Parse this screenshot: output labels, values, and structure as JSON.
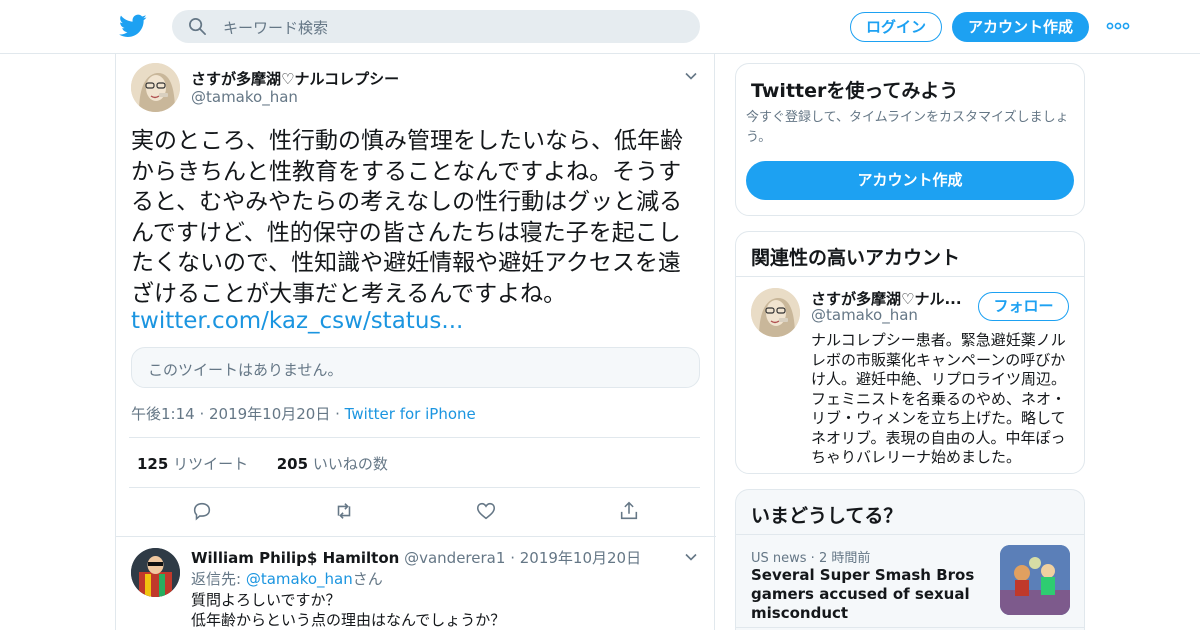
{
  "header": {
    "search_placeholder": "キーワード検索",
    "login_label": "ログイン",
    "signup_label": "アカウント作成"
  },
  "tweet": {
    "author_name": "さすが多摩湖♡ナルコレプシー",
    "author_handle": "@tamako_han",
    "text": "実のところ、性行動の慎み管理をしたいなら、低年齢からきちんと性教育をすることなんですよね。そうすると、むやみやたらの考えなしの性行動はグッと減るんですけど、性的保守の皆さんたちは寝た子を起こしたくないので、性知識や避妊情報や避妊アクセスを遠ざけることが大事だと考えるんですよね。",
    "link": "twitter.com/kaz_csw/status...",
    "quote_unavailable": "このツイートはありません。",
    "time": "午後1:14",
    "date": "2019年10月20日",
    "source": "Twitter for iPhone",
    "retweet_count": "125",
    "retweet_label": "リツイート",
    "like_count": "205",
    "like_label": "いいねの数"
  },
  "reply": {
    "name": "William Philip$ Hamilton",
    "handle": "@vanderera1",
    "date": "2019年10月20日",
    "reply_to_label": "返信先:",
    "reply_to_handle": "@tamako_han",
    "reply_to_suffix": "さん",
    "line1": "質問よろしいですか？",
    "line2": "低年齢からという点の理由はなんでしょうか？"
  },
  "sidebar": {
    "try_title": "Twitterを使ってみよう",
    "try_subtitle": "今すぐ登録して、タイムラインをカスタマイズしましょう。",
    "try_button": "アカウント作成",
    "related_title": "関連性の高いアカウント",
    "related_name": "さすが多摩湖♡ナル...",
    "related_handle": "@tamako_han",
    "follow_label": "フォロー",
    "related_bio": "ナルコレプシー患者。緊急避妊薬ノルレボの市販薬化キャンペーンの呼びかけ人。避妊中絶、リプロライツ周辺。フェミニストを名乗るのやめ、ネオ・リブ・ウィメンを立ち上げた。略してネオリブ。表現の自由の人。中年ぽっちゃりバレリーナ始めました。",
    "trends_title": "いまどうしてる？",
    "trend_category": "US news",
    "trend_time": "2 時間前",
    "trend_headline": "Several Super Smash Bros gamers accused of sexual misconduct"
  },
  "colors": {
    "accent": "#1da1f2",
    "link": "#1b95e0",
    "text": "#14171a",
    "secondary": "#657786",
    "border": "#e1e8ed"
  },
  "icons": [
    "twitter-logo-icon",
    "search-icon",
    "more-dots-icon",
    "chevron-down-icon",
    "reply-icon",
    "retweet-icon",
    "like-icon",
    "share-icon"
  ]
}
